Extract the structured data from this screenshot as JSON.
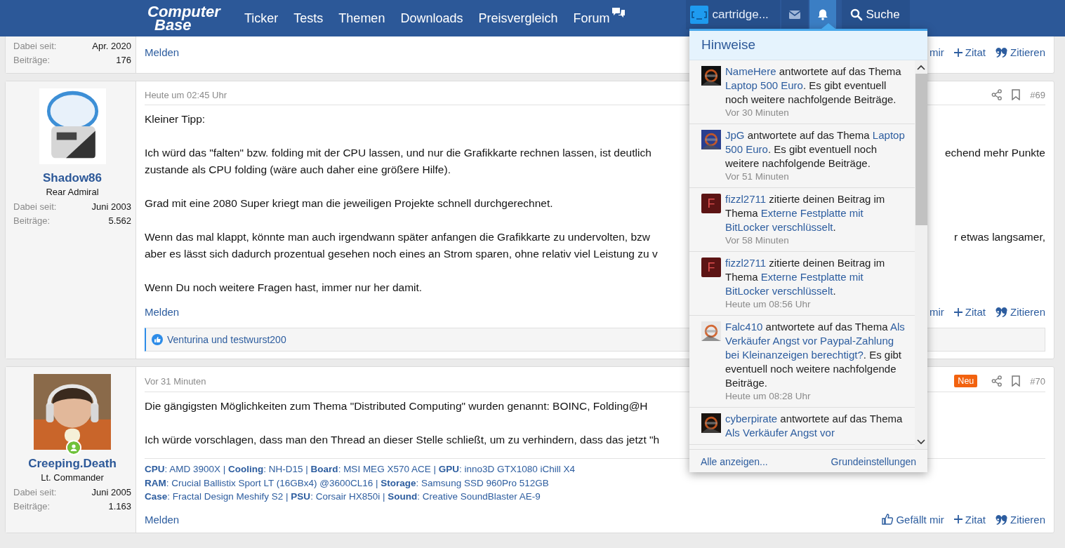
{
  "header": {
    "logo": [
      "Computer",
      "Base"
    ],
    "nav": [
      {
        "label": "Ticker",
        "icon": false
      },
      {
        "label": "Tests",
        "icon": false
      },
      {
        "label": "Themen",
        "icon": false
      },
      {
        "label": "Downloads",
        "icon": false
      },
      {
        "label": "Preisvergleich",
        "icon": false
      },
      {
        "label": "Forum",
        "icon": true
      }
    ],
    "user": "cartridge...",
    "bell_selected": true,
    "search": "Suche"
  },
  "posts": [
    {
      "stats": [
        {
          "label": "Dabei seit:",
          "value": "Apr. 2020"
        },
        {
          "label": "Beiträge:",
          "value": "176"
        }
      ],
      "actions": {
        "report": "Melden",
        "like": {
          "text": "mir",
          "icon": false
        },
        "quote": "Zitat",
        "reply": "Zitieren"
      }
    },
    {
      "user": {
        "avatar": {
          "kind": "picture"
        },
        "online": false,
        "name": "Shadow86",
        "rank": "Rear Admiral"
      },
      "stats": [
        {
          "label": "Dabei seit:",
          "value": "Juni 2003"
        },
        {
          "label": "Beiträge:",
          "value": "5.562"
        }
      ],
      "date": "Heute um 02:45 Uhr",
      "number": "#69",
      "paragraphs": [
        [
          {
            "text": "Kleiner Tipp:"
          }
        ],
        [
          {
            "text": "Ich würd das \"falten\" bzw. folding mit der CPU lassen, und nur die Grafikkarte rechnen lassen, ist deutlich",
            "tail": "echend mehr Punkte"
          },
          {
            "text": "zustande als CPU folding (wäre auch daher eine größere Hilfe)."
          }
        ],
        [
          {
            "text": "Grad mit eine 2080 Super kriegt man die jeweiligen Projekte schnell durchgerechnet."
          }
        ],
        [
          {
            "text": "Wenn das mal klappt, könnte man auch irgendwann später anfangen die Grafikkarte zu undervolten, bzw",
            "tail": "r etwas langsamer,"
          },
          {
            "text": "aber es lässt sich dadurch prozentual gesehen noch eines an Strom sparen, ohne relativ viel Leistung zu v"
          }
        ],
        [
          {
            "text": "Wenn Du noch weitere Fragen hast, immer nur her damit."
          }
        ]
      ],
      "actions": {
        "report": "Melden",
        "like": {
          "text": "mir",
          "icon": false
        },
        "quote": "Zitat",
        "reply": "Zitieren"
      },
      "likes": "Venturina und testwurst200"
    },
    {
      "user": {
        "avatar": {
          "kind": "picture"
        },
        "online": true,
        "name": "Creeping.Death",
        "rank": "Lt. Commander"
      },
      "stats": [
        {
          "label": "Dabei seit:",
          "value": "Juni 2005"
        },
        {
          "label": "Beiträge:",
          "value": "1.163"
        }
      ],
      "date": "Vor 31 Minuten",
      "new_badge": "Neu",
      "number": "#70",
      "paragraphs": [
        [
          {
            "text": "Die gängigsten Möglichkeiten zum Thema \"Distributed Computing\" wurden genannt: BOINC, Folding@H"
          }
        ],
        [
          {
            "text": "Ich würde vorschlagen, dass man den Thread an dieser Stelle schließt, um zu verhindern, dass das jetzt \"h"
          }
        ]
      ],
      "signature": [
        "**CPU**: AMD 3900X | **Cooling**: NH-D15 | **Board**: MSI MEG X570 ACE | **GPU**: inno3D GTX1080 iChill X4",
        "**RAM**: Crucial Ballistix Sport LT (16GBx4) @3600CL16 | **Storage**: Samsung SSD 960Pro 512GB",
        "**Case**: Fractal Design Meshify S2 | **PSU**: Corsair HX850i | **Sound**: Creative SoundBlaster AE-9"
      ],
      "actions": {
        "report": "Melden",
        "like": {
          "text": "Gefällt mir",
          "icon": true
        },
        "quote": "Zitat",
        "reply": "Zitieren"
      }
    }
  ],
  "notifications": {
    "title": "Hinweise",
    "items": [
      {
        "avatar": {
          "kind": "picture"
        },
        "segments": [
          {
            "kind": "user",
            "text": "NameHere"
          },
          {
            "kind": "plain",
            "text": " antwortete auf das Thema "
          },
          {
            "kind": "topic",
            "text": "Laptop 500 Euro"
          },
          {
            "kind": "plain",
            "text": ". Es gibt eventuell noch weitere nachfolgende Beiträge."
          }
        ],
        "time": "Vor 30 Minuten"
      },
      {
        "avatar": {
          "kind": "picture"
        },
        "segments": [
          {
            "kind": "user",
            "text": "JpG"
          },
          {
            "kind": "plain",
            "text": " antwortete auf das Thema "
          },
          {
            "kind": "topic",
            "text": "Laptop 500 Euro"
          },
          {
            "kind": "plain",
            "text": ". Es gibt eventuell noch weitere nachfolgende Beiträge."
          }
        ],
        "time": "Vor 51 Minuten"
      },
      {
        "avatar": {
          "kind": "letter",
          "letter": "F"
        },
        "segments": [
          {
            "kind": "user",
            "text": "fizzl2711"
          },
          {
            "kind": "plain",
            "text": " zitierte deinen Beitrag im Thema "
          },
          {
            "kind": "topic",
            "text": "Externe Festplatte mit BitLocker verschlüsselt"
          },
          {
            "kind": "plain",
            "text": "."
          }
        ],
        "time": "Vor 58 Minuten"
      },
      {
        "avatar": {
          "kind": "letter",
          "letter": "F"
        },
        "segments": [
          {
            "kind": "user",
            "text": "fizzl2711"
          },
          {
            "kind": "plain",
            "text": " zitierte deinen Beitrag im Thema "
          },
          {
            "kind": "topic",
            "text": "Externe Festplatte mit BitLocker verschlüsselt"
          },
          {
            "kind": "plain",
            "text": "."
          }
        ],
        "time": "Heute um 08:56 Uhr"
      },
      {
        "avatar": {
          "kind": "picture"
        },
        "segments": [
          {
            "kind": "user",
            "text": "Falc410"
          },
          {
            "kind": "plain",
            "text": " antwortete auf das Thema "
          },
          {
            "kind": "topic",
            "text": "Als Verkäufer Angst vor Paypal-Zahlung bei Kleinanzeigen berechtigt?"
          },
          {
            "kind": "plain",
            "text": ". Es gibt eventuell noch weitere nachfolgende Beiträge."
          }
        ],
        "time": "Heute um 08:28 Uhr"
      },
      {
        "avatar": {
          "kind": "picture"
        },
        "segments": [
          {
            "kind": "user",
            "text": "cyberpirate"
          },
          {
            "kind": "plain",
            "text": " antwortete auf das Thema "
          },
          {
            "kind": "topic",
            "text": "Als Verkäufer Angst vor"
          }
        ]
      }
    ],
    "footer": {
      "all": "Alle anzeigen...",
      "settings": "Grundeinstellungen"
    }
  }
}
